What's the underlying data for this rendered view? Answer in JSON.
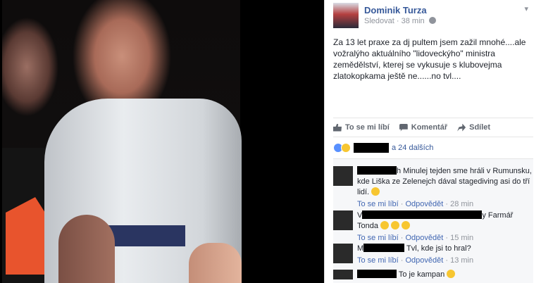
{
  "post": {
    "author": "Dominik Turza",
    "follow": "Sledovat",
    "time": "38 min",
    "text": "Za 13 let praxe za dj pultem jsem zažil mnohé....ale vožralýho aktuálního \"lidoveckýho\" ministra zemědělství, kterej se vykusuje s klubovejma zlatokopkama ještě ne......no tvl....",
    "actions": {
      "like": "To se mi líbí",
      "comment": "Komentář",
      "share": "Sdílet"
    },
    "reactions_suffix": "a 24 dalších"
  },
  "comments": [
    {
      "text": "h Minulej tejden sme hráli v Rumunsku, kde Liška ze Zelenejch dával stagediving asi do tří lidí.",
      "like": "To se mi líbí",
      "reply": "Odpovědět",
      "time": "28 min"
    },
    {
      "prefix": "V",
      "suffix": "y Farmář",
      "text": "Tonda",
      "like": "To se mi líbí",
      "reply": "Odpovědět",
      "time": "15 min"
    },
    {
      "prefix": "M",
      "text": "Tvl, kde jsi to hral?",
      "like": "To se mi líbí",
      "reply": "Odpovědět",
      "time": "13 min"
    },
    {
      "text": "To je kampan"
    }
  ],
  "icons": {
    "globe": "globe-icon",
    "chevron": "chevron-down-icon",
    "like": "like-icon",
    "comment": "comment-icon",
    "share": "share-icon",
    "reaction_like": "like-reaction-icon",
    "reaction_haha": "haha-reaction-icon"
  },
  "colors": {
    "link": "#365899",
    "meta": "#90949c",
    "action": "#616770"
  }
}
